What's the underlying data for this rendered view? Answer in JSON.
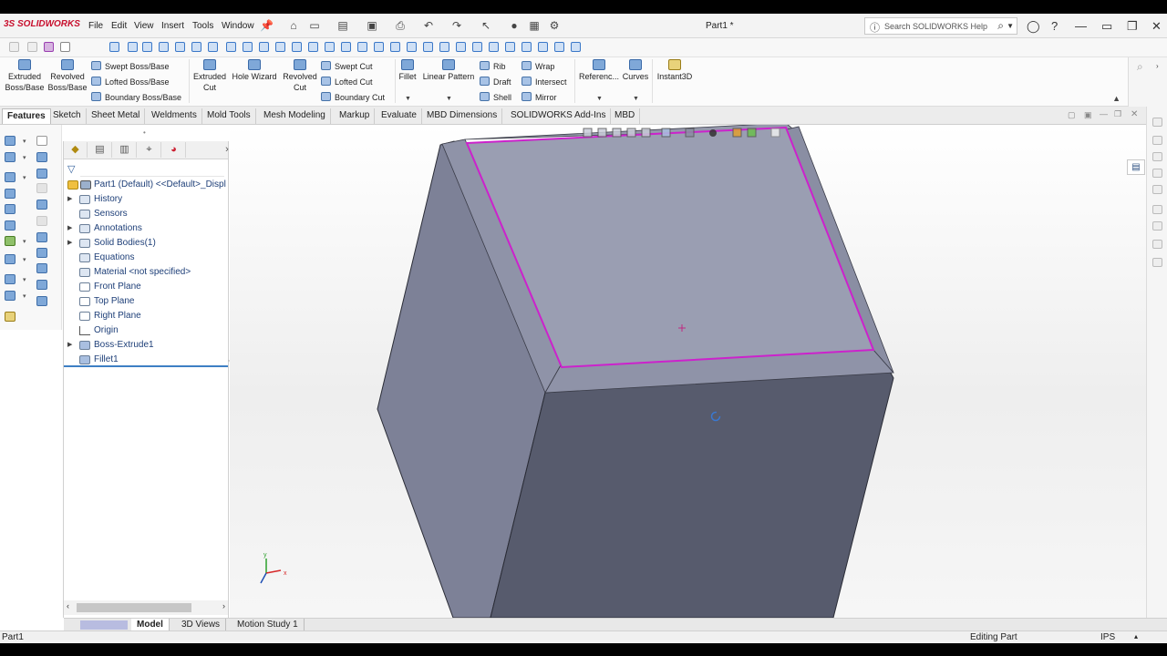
{
  "app": {
    "logo": "3S SOLIDWORKS",
    "doc_title": "Part1 *",
    "search_placeholder": "Search SOLIDWORKS Help",
    "menu": [
      "File",
      "Edit",
      "View",
      "Insert",
      "Tools",
      "Window"
    ],
    "pin": "📌"
  },
  "ribbon": {
    "extruded_boss": "Extruded Boss/Base",
    "revolved_boss": "Revolved Boss/Base",
    "swept_boss": "Swept Boss/Base",
    "lofted_boss": "Lofted Boss/Base",
    "boundary_boss": "Boundary Boss/Base",
    "extruded_cut": "Extruded Cut",
    "hole_wizard": "Hole Wizard",
    "revolved_cut": "Revolved Cut",
    "swept_cut": "Swept Cut",
    "lofted_cut": "Lofted Cut",
    "boundary_cut": "Boundary Cut",
    "fillet": "Fillet",
    "linear_pattern": "Linear Pattern",
    "rib": "Rib",
    "draft": "Draft",
    "shell": "Shell",
    "wrap": "Wrap",
    "intersect": "Intersect",
    "mirror": "Mirror",
    "reference": "Referenc...",
    "curves": "Curves",
    "instant3d": "Instant3D"
  },
  "tabs": [
    "Features",
    "Sketch",
    "Sheet Metal",
    "Weldments",
    "Mold Tools",
    "Mesh Modeling",
    "Markup",
    "Evaluate",
    "MBD Dimensions",
    "SOLIDWORKS Add-Ins",
    "MBD"
  ],
  "tree": {
    "root": "Part1 (Default) <<Default>_Displ",
    "items": [
      {
        "label": "History",
        "expandable": true
      },
      {
        "label": "Sensors",
        "expandable": false
      },
      {
        "label": "Annotations",
        "expandable": true
      },
      {
        "label": "Solid Bodies(1)",
        "expandable": true
      },
      {
        "label": "Equations",
        "expandable": false
      },
      {
        "label": "Material <not specified>",
        "expandable": false
      },
      {
        "label": "Front Plane",
        "expandable": false
      },
      {
        "label": "Top Plane",
        "expandable": false
      },
      {
        "label": "Right Plane",
        "expandable": false
      },
      {
        "label": "Origin",
        "expandable": false
      },
      {
        "label": "Boss-Extrude1",
        "expandable": true
      },
      {
        "label": "Fillet1",
        "expandable": false
      }
    ]
  },
  "bottom_tabs": [
    "Model",
    "3D Views",
    "Motion Study 1"
  ],
  "status": {
    "left": "Part1",
    "mode": "Editing Part",
    "units": "IPS"
  },
  "triad": {
    "x": "x",
    "y": "y"
  },
  "colors": {
    "selection_edge": "#cc22cc",
    "model_face_top": "#9a9eb2",
    "model_face_left": "#7d8197",
    "model_face_front": "#565a6c"
  }
}
